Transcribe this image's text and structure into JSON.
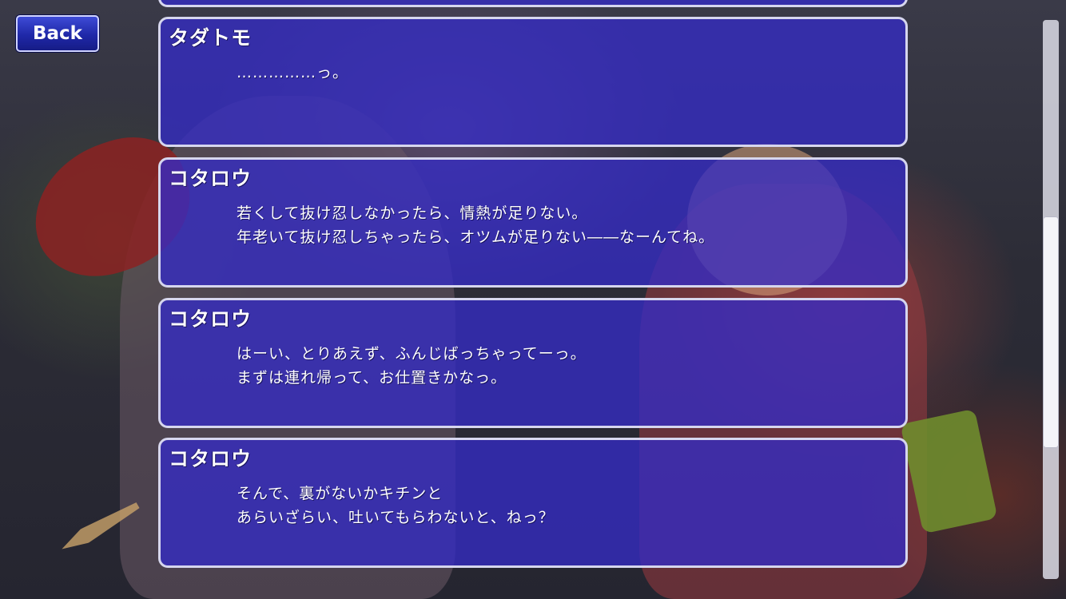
{
  "nav": {
    "back_label": "Back"
  },
  "log": {
    "entries": [
      {
        "speaker": "タダトモ",
        "lines": [
          "……………っ。"
        ]
      },
      {
        "speaker": "コタロウ",
        "lines": [
          "若くして抜け忍しなかったら、情熱が足りない。",
          "年老いて抜け忍しちゃったら、オツムが足りない――なーんてね。"
        ]
      },
      {
        "speaker": "コタロウ",
        "lines": [
          "はーい、とりあえず、ふんじばっちゃってーっ。",
          "まずは連れ帰って、お仕置きかなっ。"
        ]
      },
      {
        "speaker": "コタロウ",
        "lines": [
          "そんで、裏がないかキチンと",
          "あらいざらい、吐いてもらわないと、ねっ？"
        ]
      }
    ]
  },
  "scrollbar": {
    "position_fraction": 0.6
  },
  "colors": {
    "dialog_fill": "#342cc4",
    "dialog_border": "#d6d6ee",
    "button_fill": "#1f28a8",
    "text": "#ffffff"
  }
}
